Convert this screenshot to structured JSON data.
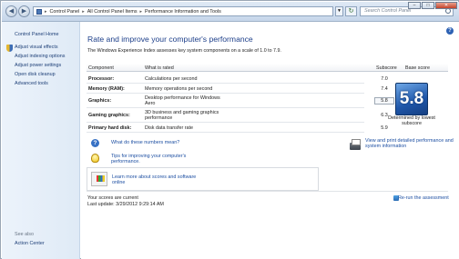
{
  "address_bar": {
    "crumbs": [
      "Control Panel",
      "All Control Panel Items",
      "Performance Information and Tools"
    ]
  },
  "search": {
    "placeholder": "Search Control Panel"
  },
  "left_pane": {
    "home": "Control Panel Home",
    "links": [
      "Adjust visual effects",
      "Adjust indexing options",
      "Adjust power settings",
      "Open disk cleanup",
      "Advanced tools"
    ],
    "see_also": "See also",
    "action_center": "Action Center"
  },
  "main": {
    "title": "Rate and improve your computer's performance",
    "description": "The Windows Experience Index assesses key system components on a scale of 1.0 to 7.9.",
    "headers": {
      "component": "Component",
      "rated": "What is rated",
      "subscore": "Subscore",
      "base": "Base score"
    },
    "rows": [
      {
        "component": "Processor:",
        "rated": "Calculations per second",
        "score": "7.0"
      },
      {
        "component": "Memory (RAM):",
        "rated": "Memory operations per second",
        "score": "7.4"
      },
      {
        "component": "Graphics:",
        "rated": "Desktop performance for Windows Aero",
        "score": "5.8"
      },
      {
        "component": "Gaming graphics:",
        "rated": "3D business and gaming graphics performance",
        "score": "6.3"
      },
      {
        "component": "Primary hard disk:",
        "rated": "Disk data transfer rate",
        "score": "5.9"
      }
    ],
    "base_score": "5.8",
    "base_caption": "Determined by lowest subscore",
    "links": {
      "numbers": "What do these numbers mean?",
      "print": "View and print detailed performance and system information",
      "tips": "Tips for improving your computer's performance.",
      "learn": "Learn more about scores and software online"
    },
    "status_current": "Your scores are current",
    "last_update": "Last update: 3/29/2012 9:29:14 AM",
    "rerun": "Re-run the assessment"
  }
}
